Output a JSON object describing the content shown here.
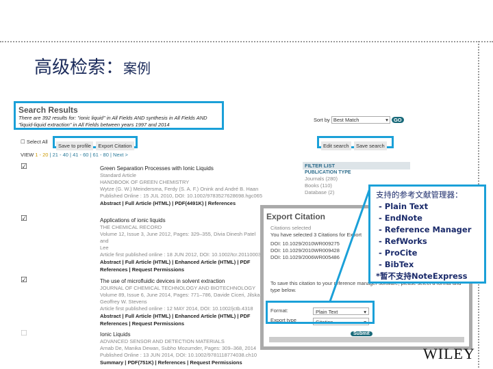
{
  "slide": {
    "title": "高级检索：",
    "title_suffix": "案例",
    "logo": "WILEY"
  },
  "search": {
    "heading": "Search Results",
    "summary": "There are 392 results for: \"ionic liquid\" in All Fields AND synthesis in All Fields AND \"liquid-liquid extraction\" in All Fields between years 1997 and 2014",
    "select_all": "Select All",
    "save_to_profile": "Save to profile",
    "export_citation": "Export Citation",
    "view_label": "VIEW",
    "pages": [
      "1 - 20",
      "21 - 40",
      "41 - 60",
      "61 - 80"
    ],
    "next": "Next >",
    "sort_label": "Sort by",
    "sort_value": "Best Match",
    "go": "GO",
    "edit_search": "Edit search",
    "save_search": "Save search",
    "filter": {
      "heading": "FILTER LIST",
      "type": "PUBLICATION TYPE",
      "items": [
        "Journals (280)",
        "Books (110)",
        "Database (2)"
      ]
    }
  },
  "results": [
    {
      "title": "Green Separation Processes with Ionic Liquids",
      "lines": [
        "Standard Article",
        "HANDBOOK OF GREEN CHEMISTRY",
        "Wytze (G. W.) Meindersma, Ferdy (S. A. F.) Onink and André B. Haan",
        "Published Online : 15 JUL 2010, DOI: 10.1002/9783527628698.hgc065"
      ],
      "links": "Abstract | Full Article (HTML) | PDF(4491K) | References",
      "checked": true
    },
    {
      "title": "Applications of ionic liquids",
      "lines": [
        "THE CHEMICAL RECORD",
        "Volume 12, Issue 3, June 2012, Pages: 329–355, Divia Dinesh Patel and",
        "Lee",
        "Article first published online : 18 JUN 2012, DOI: 10.1002/tcr.201100036"
      ],
      "links": "Abstract | Full Article (HTML) | Enhanced Article (HTML) | PDF",
      "links2": "References | Request Permissions",
      "checked": true
    },
    {
      "title": "The use of microfluidic devices in solvent extraction",
      "lines": [
        "JOURNAL OF CHEMICAL TECHNOLOGY AND BIOTECHNOLOGY",
        "Volume 89, Issue 6, June 2014, Pages: 771–786, Davide Ciceri, Jilska",
        "Geoffrey W. Stevens",
        "Article first published online : 12 MAY 2014, DOI: 10.1002/jctb.4318"
      ],
      "links": "Abstract | Full Article (HTML) | Enhanced Article (HTML) | PDF",
      "links2": "References | Request Permissions",
      "checked": true
    },
    {
      "title": "Ionic Liquids",
      "lines": [
        "ADVANCED SENSOR AND DETECTION MATERIALS",
        "Arnab De, Manika Dewan, Subho Mozumder, Pages: 309–368, 2014",
        "Published Online : 13 JUN 2014, DOI: 10.1002/9781118774038.ch10"
      ],
      "links": "Summary | PDF(751K) | References | Request Permissions",
      "checked": false
    }
  ],
  "dialog": {
    "title": "Export Citation",
    "selected_heading": "Citations selected",
    "selected_text": "You have selected 3 Citations for Export",
    "dois": [
      "DOI: 10.1029/2010WR009275",
      "DOI: 10.1029/2010WR009428",
      "DOI: 10.1029/2006WR005486"
    ],
    "instructions": "To save this citation to your reference manager software, please select a format and type below.",
    "format_label": "Format:",
    "format_value": "Plain Text",
    "type_label": "Export type",
    "type_value": "Citation",
    "submit": "Submit"
  },
  "callout": {
    "heading": "支持的参考文献管理器：",
    "items": [
      "Plain Text",
      "EndNote",
      "Reference Manager",
      "RefWorks",
      "ProCite",
      "BibTex"
    ],
    "note": "*暂不支持NoteExpress"
  },
  "colors": {
    "highlight": "#1aa0d8",
    "title": "#1a2a5a",
    "link": "#2a7a9a"
  }
}
